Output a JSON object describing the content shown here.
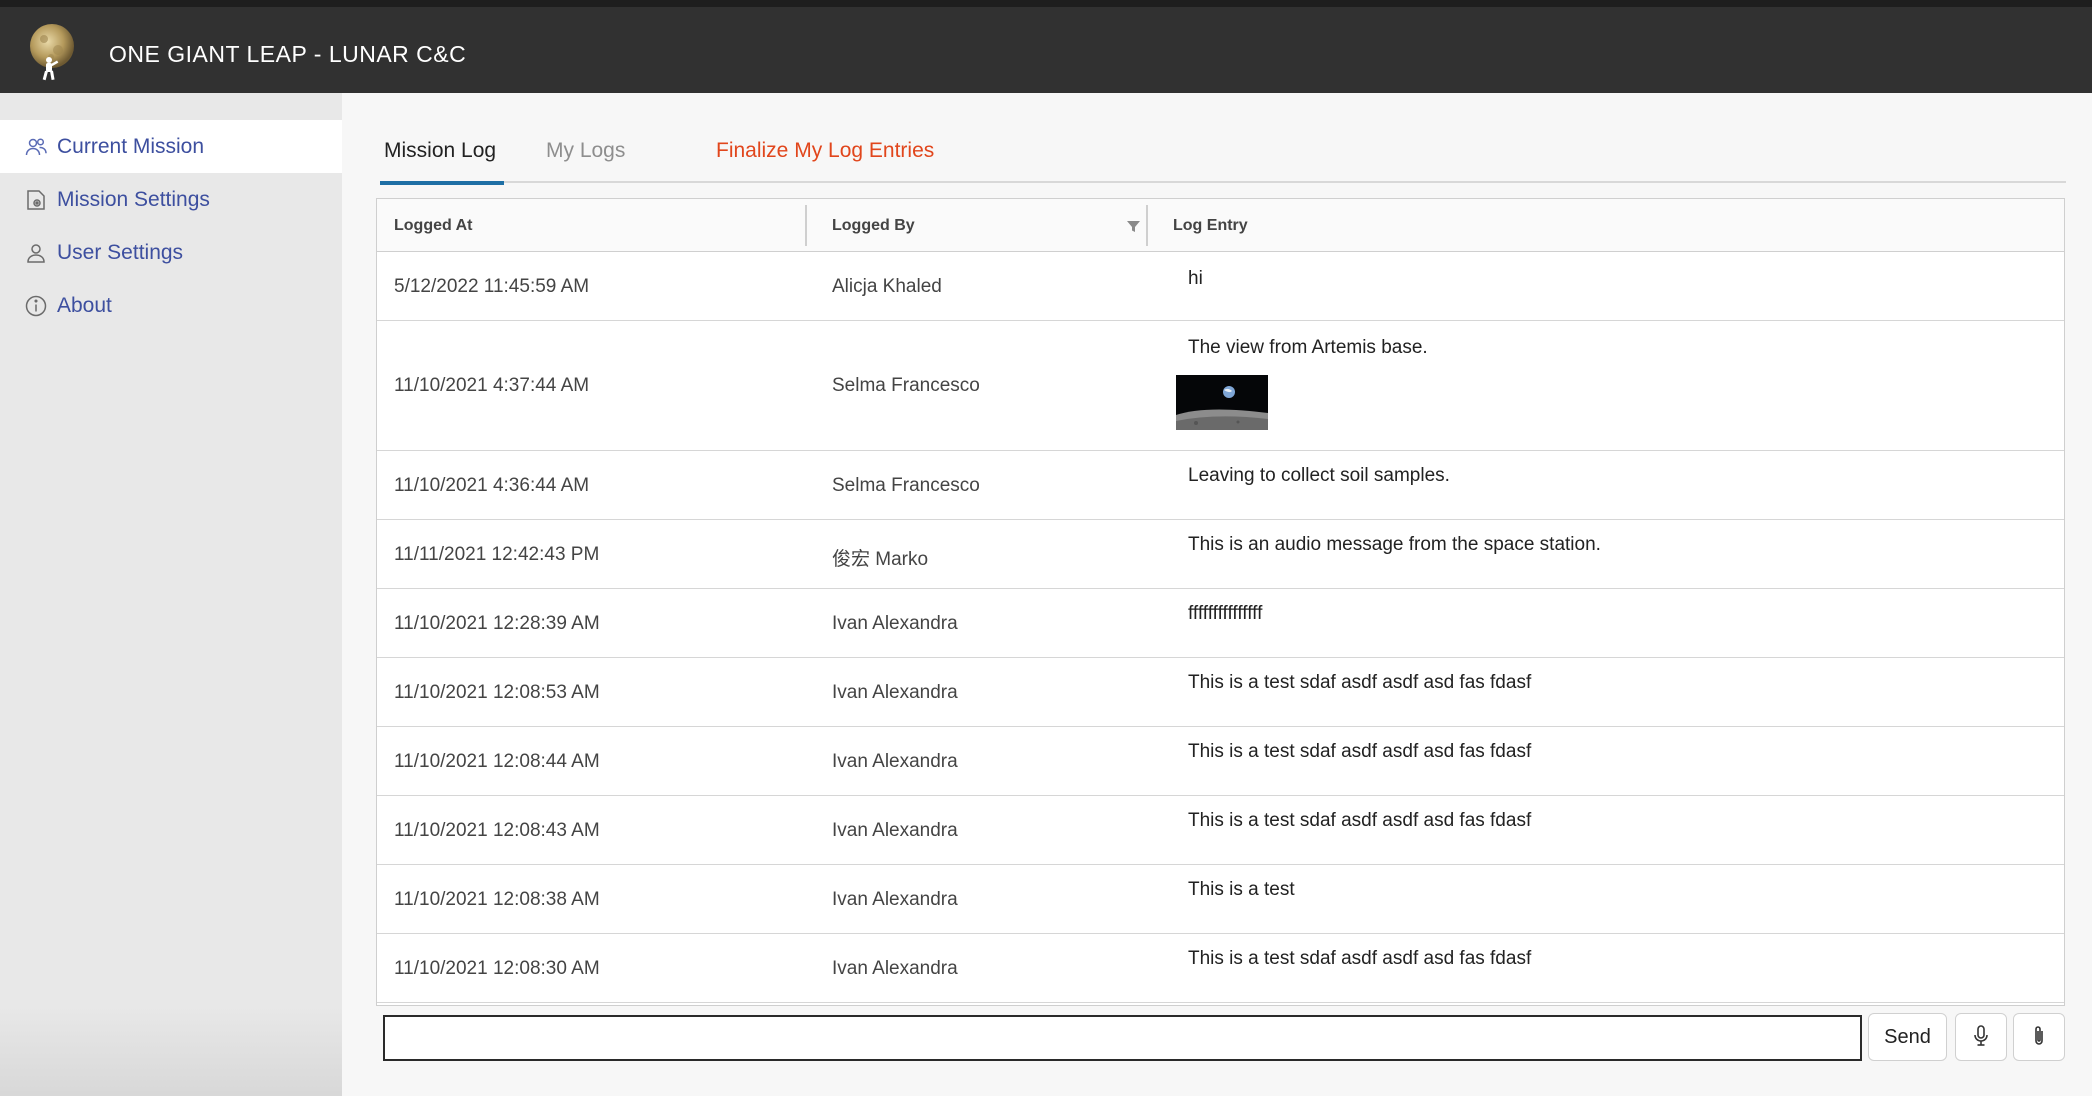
{
  "header": {
    "title": "ONE GIANT LEAP - LUNAR C&C",
    "logo_icon": "moon-astronaut-logo"
  },
  "sidebar": {
    "items": [
      {
        "label": "Current Mission",
        "icon": "users-icon",
        "active": true
      },
      {
        "label": "Mission Settings",
        "icon": "settings-document-icon",
        "active": false
      },
      {
        "label": "User Settings",
        "icon": "user-icon",
        "active": false
      },
      {
        "label": "About",
        "icon": "info-icon",
        "active": false
      }
    ]
  },
  "tabs": [
    {
      "label": "Mission Log",
      "active": true
    },
    {
      "label": "My Logs",
      "active": false
    },
    {
      "label": "Finalize My Log Entries",
      "active": false,
      "color": "#e1461c"
    }
  ],
  "grid": {
    "columns": [
      "Logged At",
      "Logged By",
      "Log Entry"
    ],
    "rows": [
      {
        "logged_at": "5/12/2022 11:45:59 AM",
        "logged_by": "Alicja Khaled",
        "entry": "hi"
      },
      {
        "logged_at": "11/10/2021 4:37:44 AM",
        "logged_by": "Selma Francesco",
        "entry": "The view from Artemis base.",
        "has_image": true
      },
      {
        "logged_at": "11/10/2021 4:36:44 AM",
        "logged_by": "Selma Francesco",
        "entry": "Leaving to collect soil samples."
      },
      {
        "logged_at": "11/11/2021 12:42:43 PM",
        "logged_by": "俊宏 Marko",
        "entry": "This is an audio message from the space station."
      },
      {
        "logged_at": "11/10/2021 12:28:39 AM",
        "logged_by": "Ivan Alexandra",
        "entry": "fffffffffffffff"
      },
      {
        "logged_at": "11/10/2021 12:08:53 AM",
        "logged_by": "Ivan Alexandra",
        "entry": "This is a test sdaf asdf asdf asd fas fdasf"
      },
      {
        "logged_at": "11/10/2021 12:08:44 AM",
        "logged_by": "Ivan Alexandra",
        "entry": "This is a test sdaf asdf asdf asd fas fdasf"
      },
      {
        "logged_at": "11/10/2021 12:08:43 AM",
        "logged_by": "Ivan Alexandra",
        "entry": "This is a test sdaf asdf asdf asd fas fdasf"
      },
      {
        "logged_at": "11/10/2021 12:08:38 AM",
        "logged_by": "Ivan Alexandra",
        "entry": "This is a test"
      },
      {
        "logged_at": "11/10/2021 12:08:30 AM",
        "logged_by": "Ivan Alexandra",
        "entry": "This is a test sdaf asdf asdf asd fas fdasf"
      }
    ]
  },
  "composer": {
    "value": "",
    "placeholder": "",
    "send_label": "Send",
    "mic_icon": "microphone-icon",
    "attach_icon": "paperclip-icon"
  },
  "colors": {
    "header_bg": "#313131",
    "sidebar_bg": "#e8e8e8",
    "nav_text": "#3d4f9f",
    "tab_underline": "#1e6fa5",
    "finalize_tab": "#e1461c"
  }
}
